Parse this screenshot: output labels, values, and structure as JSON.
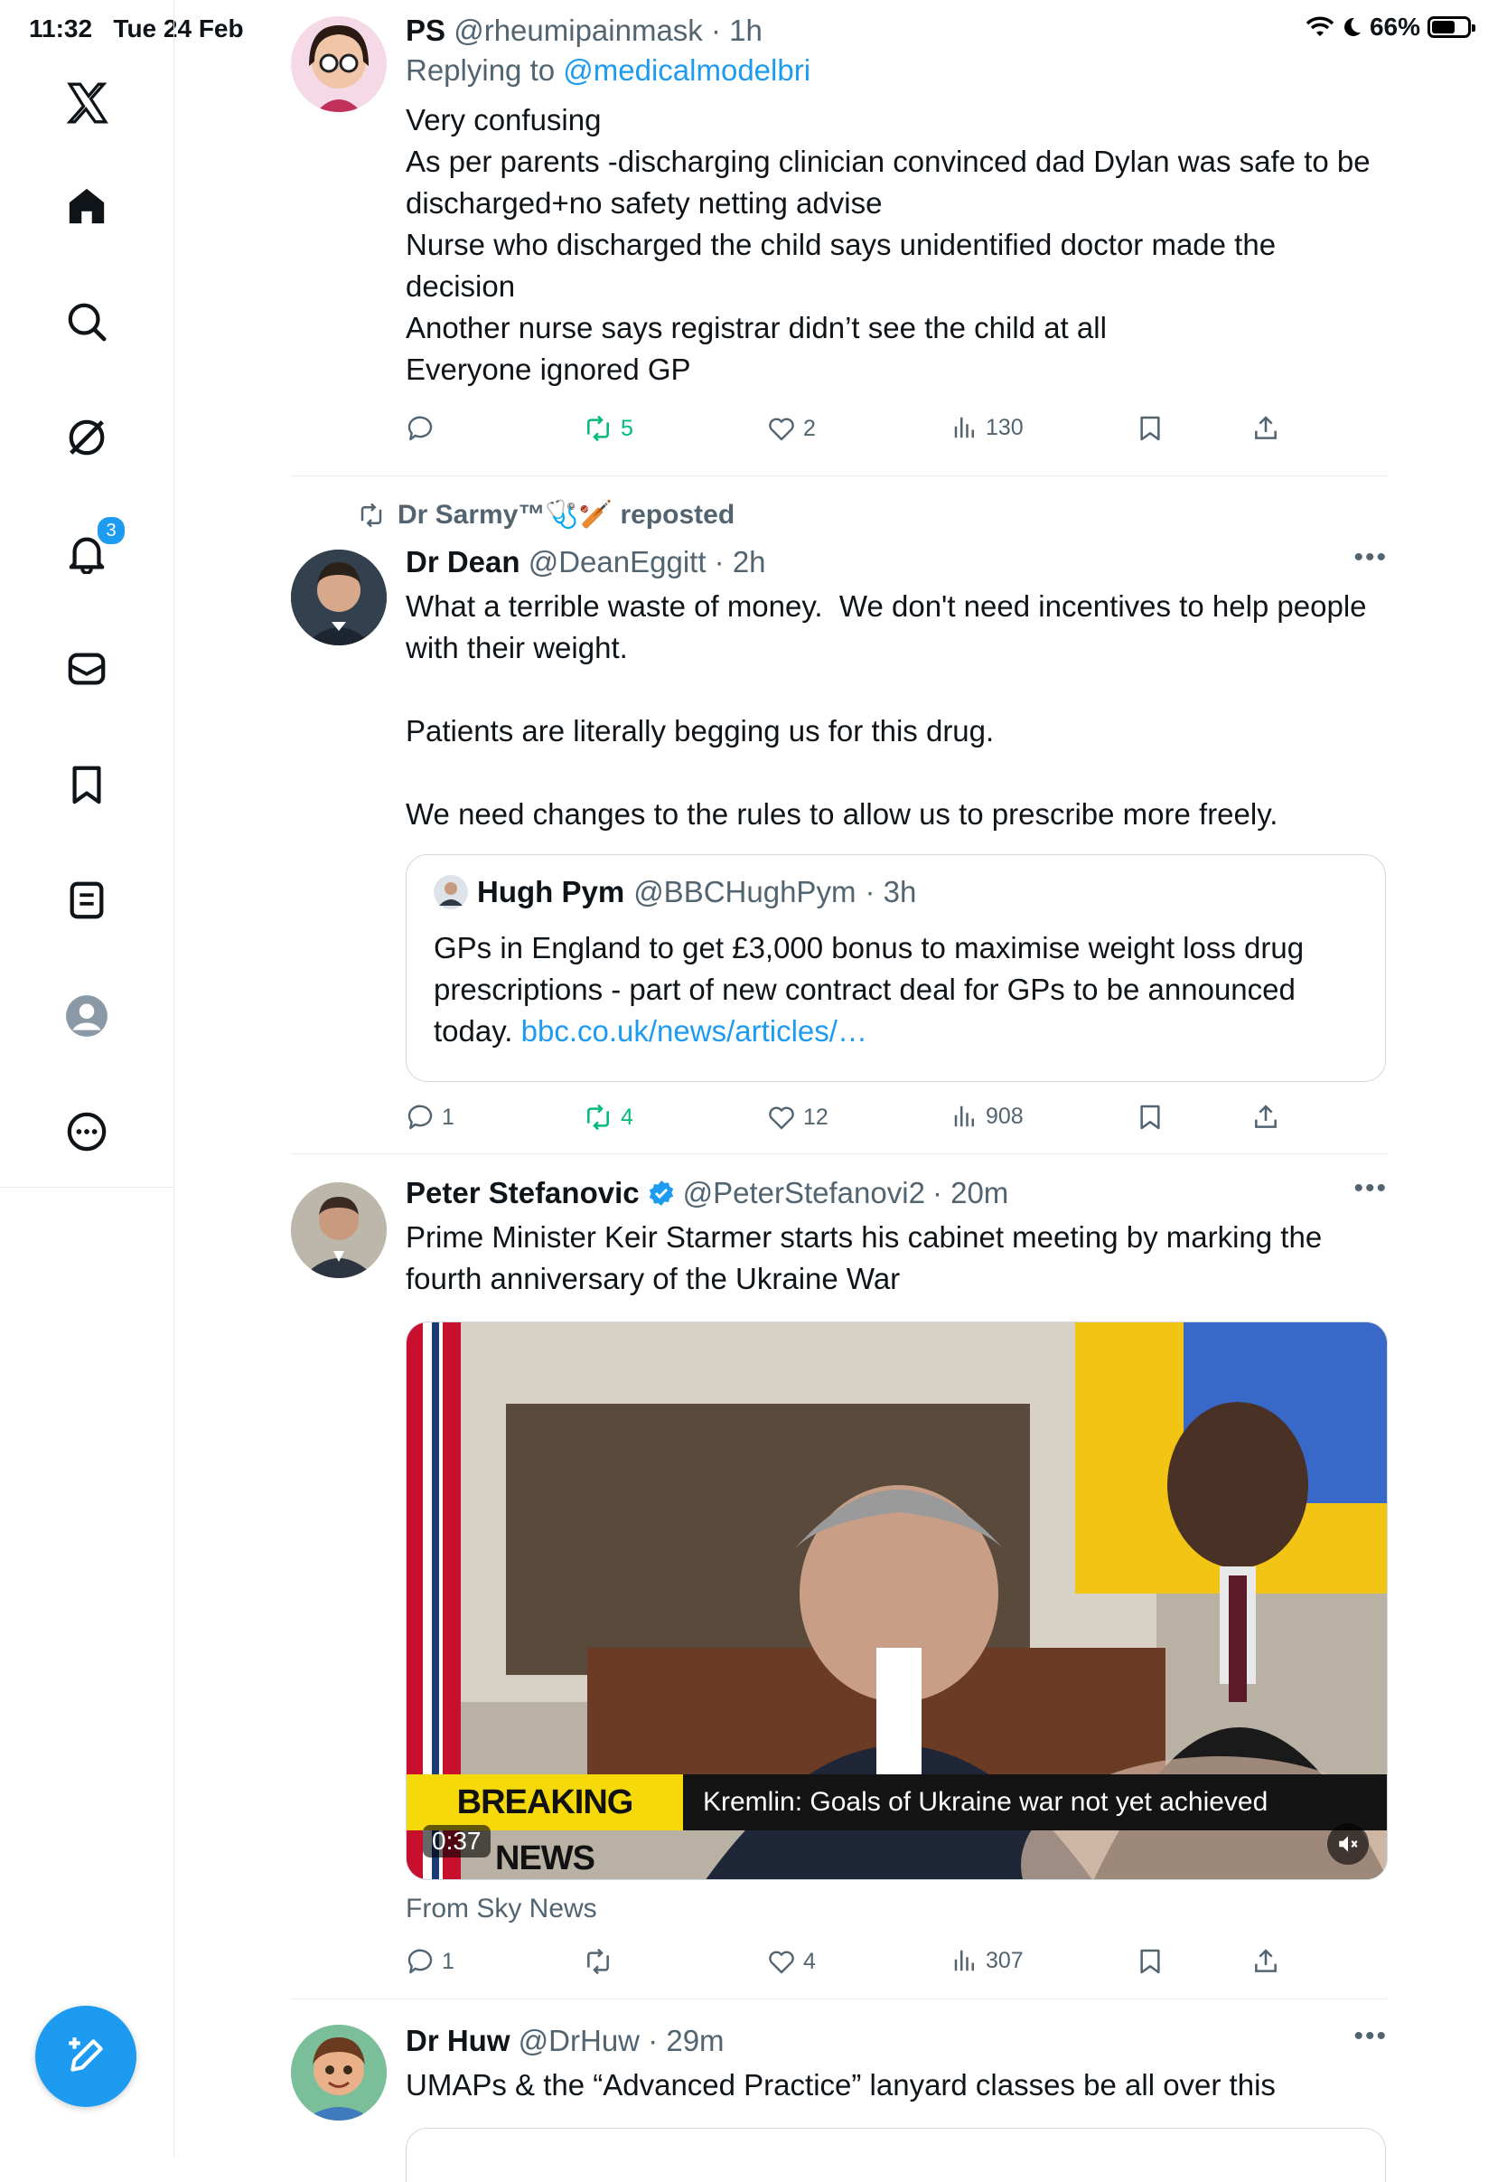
{
  "status_bar": {
    "time": "11:32",
    "date": "Tue 24 Feb",
    "battery": "66%",
    "battery_level": 0.66
  },
  "sidebar": {
    "items": [
      {
        "name": "x-logo-icon"
      },
      {
        "name": "home-icon"
      },
      {
        "name": "search-icon"
      },
      {
        "name": "grok-icon"
      },
      {
        "name": "notifications-icon",
        "badge": "3"
      },
      {
        "name": "messages-icon"
      },
      {
        "name": "bookmarks-icon"
      },
      {
        "name": "lists-icon"
      },
      {
        "name": "profile-icon"
      },
      {
        "name": "more-icon"
      }
    ],
    "compose": "compose-icon"
  },
  "tweets": [
    {
      "name": "PS",
      "handle": "@rheumipainmask",
      "time": "· 1h",
      "replying_prefix": "Replying to ",
      "replying_to": "@medicalmodelbri",
      "text": "Very confusing\nAs per parents -discharging clinician convinced dad Dylan was safe to be discharged+no safety netting advise\nNurse who discharged the child says unidentified doctor made the decision\nAnother nurse says registrar didn’t see the child at all\nEveryone ignored GP",
      "replies": "",
      "reposts": "5",
      "likes": "2",
      "views": "130"
    },
    {
      "repost_by": "Dr Sarmy™🩺🏏 reposted",
      "name": "Dr Dean",
      "handle": "@DeanEggitt",
      "time": "· 2h",
      "text": "What a terrible waste of money.  We don't need incentives to help people with their weight.\n\nPatients are literally begging us for this drug.\n\nWe need changes to the rules to allow us to prescribe more freely.",
      "quote": {
        "name": "Hugh Pym",
        "handle": "@BBCHughPym",
        "time": "· 3h",
        "text": "GPs in England to get £3,000 bonus to maximise weight loss drug prescriptions - part of new contract deal for GPs to be announced today. ",
        "link": "bbc.co.uk/news/articles/…"
      },
      "replies": "1",
      "reposts": "4",
      "likes": "12",
      "views": "908"
    },
    {
      "name": "Peter Stefanovic",
      "handle": "@PeterStefanovi2",
      "time": "· 20m",
      "verified": true,
      "text": "Prime Minister Keir Starmer starts his cabinet meeting by marking the fourth anniversary of the Ukraine War",
      "video": {
        "breaking_label": "BREAKING NEWS",
        "headline": "Kremlin: Goals of Ukraine war not yet achieved",
        "duration": "0:37"
      },
      "from": "From Sky News",
      "replies": "1",
      "reposts": "",
      "likes": "4",
      "views": "307"
    },
    {
      "name": "Dr Huw",
      "handle": "@DrHuw",
      "time": "· 29m",
      "text": "UMAPs & the “Advanced Practice” lanyard classes be all over this"
    }
  ],
  "colors": {
    "accent": "#1d9bf0",
    "repost_green": "#00ba7c",
    "secondary_text": "#536471",
    "breaking_yellow": "#f5d90a"
  }
}
